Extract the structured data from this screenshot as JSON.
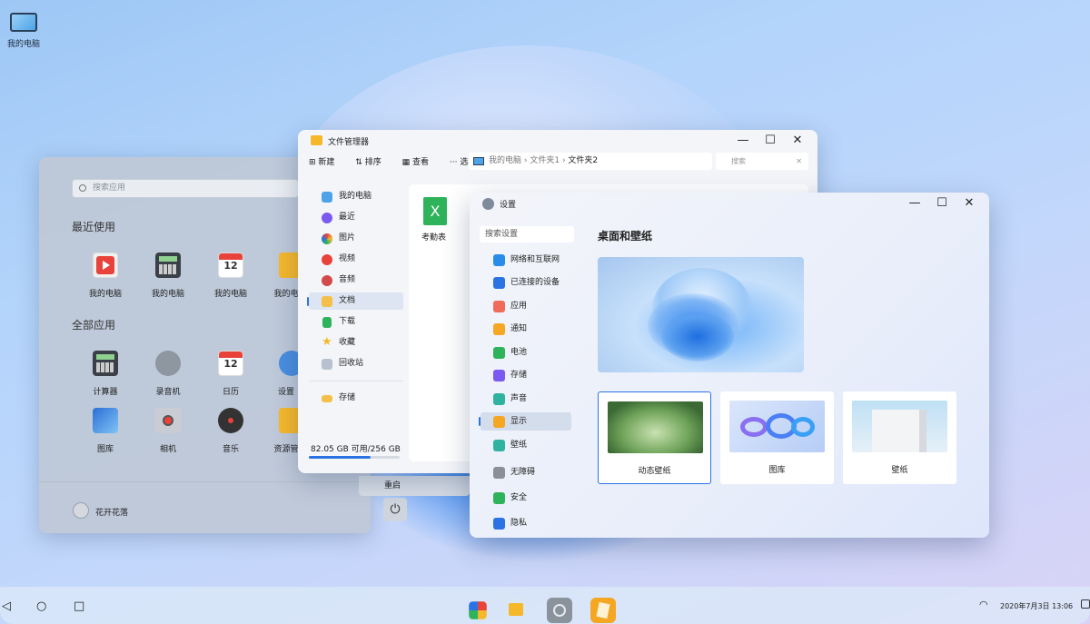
{
  "desktop": {
    "icon_label": "我的电脑"
  },
  "start_menu": {
    "search_placeholder": "搜索应用",
    "recent_title": "最近使用",
    "recent": [
      {
        "label": "我的电脑",
        "icon": "video-play-icon"
      },
      {
        "label": "我的电脑",
        "icon": "calculator-icon"
      },
      {
        "label": "我的电脑",
        "icon": "calendar-icon"
      },
      {
        "label": "我的电",
        "icon": "folder-icon"
      }
    ],
    "all_title": "全部应用",
    "all": [
      {
        "label": "计算器",
        "icon": "calculator-icon"
      },
      {
        "label": "录音机",
        "icon": "microphone-icon"
      },
      {
        "label": "日历",
        "icon": "calendar-icon"
      },
      {
        "label": "设置",
        "icon": "gear-icon"
      },
      {
        "label": "图库",
        "icon": "gallery-icon"
      },
      {
        "label": "相机",
        "icon": "camera-icon"
      },
      {
        "label": "音乐",
        "icon": "music-icon"
      },
      {
        "label": "资源管",
        "icon": "folder-icon"
      }
    ],
    "user": "花开花落",
    "restart": "重启",
    "calendar_day": "12"
  },
  "file_manager": {
    "title": "文件管理器",
    "tools": {
      "new": "新建",
      "sort": "排序",
      "view": "查看",
      "options": "选项"
    },
    "address": {
      "root": "我的电脑",
      "folder1": "文件夹1",
      "folder2": "文件夹2"
    },
    "search_placeholder": "搜索",
    "nav": [
      {
        "label": "我的电脑",
        "icon": "computer-icon"
      },
      {
        "label": "最近",
        "icon": "clock-icon"
      },
      {
        "label": "图片",
        "icon": "picture-icon"
      },
      {
        "label": "视频",
        "icon": "video-icon"
      },
      {
        "label": "音频",
        "icon": "audio-icon"
      },
      {
        "label": "文档",
        "icon": "document-icon"
      },
      {
        "label": "下载",
        "icon": "download-icon"
      },
      {
        "label": "收藏",
        "icon": "star-icon"
      },
      {
        "label": "回收站",
        "icon": "trash-icon"
      },
      {
        "label": "存储",
        "icon": "storage-icon"
      }
    ],
    "storage_text": "82.05 GB 可用/256 GB",
    "storage_used_fraction": 0.68,
    "file": {
      "name": "考勤表",
      "icon_letter": "X"
    }
  },
  "settings": {
    "title": "设置",
    "search_placeholder": "搜索设置",
    "nav": [
      {
        "label": "网络和互联网",
        "color": "#2b8be8"
      },
      {
        "label": "已连接的设备",
        "color": "#2b73e4"
      },
      {
        "label": "应用",
        "color": "#f06a5a"
      },
      {
        "label": "通知",
        "color": "#f5a623"
      },
      {
        "label": "电池",
        "color": "#2fb35a"
      },
      {
        "label": "存储",
        "color": "#7a5af0"
      },
      {
        "label": "声音",
        "color": "#2fb3a0"
      },
      {
        "label": "显示",
        "color": "#f5a623"
      },
      {
        "label": "壁纸",
        "color": "#2fb3a0"
      },
      {
        "label": "无障碍",
        "color": "#8a8f98"
      },
      {
        "label": "安全",
        "color": "#2fb35a"
      },
      {
        "label": "隐私",
        "color": "#2b73e4"
      }
    ],
    "section_title": "桌面和壁纸",
    "cards": [
      {
        "label": "动态壁纸"
      },
      {
        "label": "图库"
      },
      {
        "label": "壁纸"
      }
    ]
  },
  "taskbar": {
    "clock": "2020年7月3日 13:06"
  }
}
